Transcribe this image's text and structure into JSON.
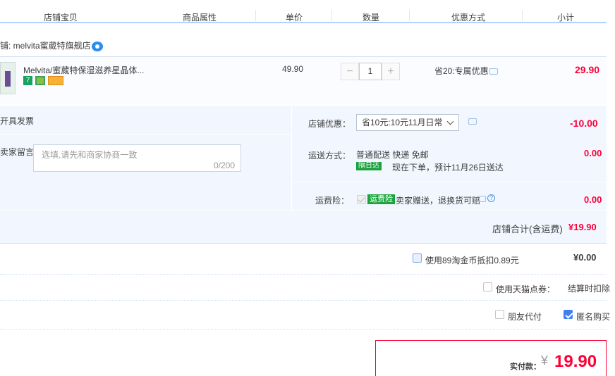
{
  "header": {
    "col_store_item": "店铺宝贝",
    "col_attrs": "商品属性",
    "col_price": "单价",
    "col_qty": "数量",
    "col_discount": "优惠方式",
    "col_subtotal": "小计"
  },
  "store": {
    "name": "铺: melvita蜜葳特旗舰店"
  },
  "item": {
    "title": "Melvita/蜜葳特保湿滋养星晶体...",
    "badges": [
      "7",
      "",
      ""
    ],
    "unit_price": "49.90",
    "quantity": "1",
    "minus": "−",
    "plus": "+",
    "promo": "省20:专属优惠",
    "subtotal": "29.90"
  },
  "options": {
    "invoice": "开具发票",
    "message_label": "卖家留言：",
    "message_placeholder": "选填,请先和商家协商一致",
    "message_counter": "0/200",
    "store_discount_label": "店铺优惠：",
    "store_discount_value": "省10元:10元11月日常",
    "store_discount_amount": "-10.00",
    "shipping_label": "运送方式：",
    "shipping_method": "普通配送 快递 免邮",
    "next_day_tag": "隔日达",
    "shipping_eta": "现在下单，预计11月26日送达",
    "shipping_amount": "0.00",
    "insurance_label": "运费险：",
    "insurance_tag": "运费险",
    "insurance_text": "卖家赠送，退换货可赔",
    "insurance_amount": "0.00",
    "store_total_label": "店铺合计(含运费)",
    "store_total_amount": "¥19.90"
  },
  "footer": {
    "taobao_coin_text": "使用89淘金币抵扣0.89元",
    "taobao_coin_amount": "¥0.00",
    "tmall_points_text": "使用天猫点券：",
    "tmall_points_note": "结算时扣除",
    "friend_pay": "朋友代付",
    "anonymous": "匿名购买",
    "pay_label": "实付款：",
    "pay_currency": "¥",
    "pay_amount": "19.90"
  },
  "colors": {
    "accent_red": "#ff0036",
    "header_line": "#b2d1ff",
    "panel_bg": "#f2f7ff",
    "checkbox_blue": "#3e7ff2"
  }
}
